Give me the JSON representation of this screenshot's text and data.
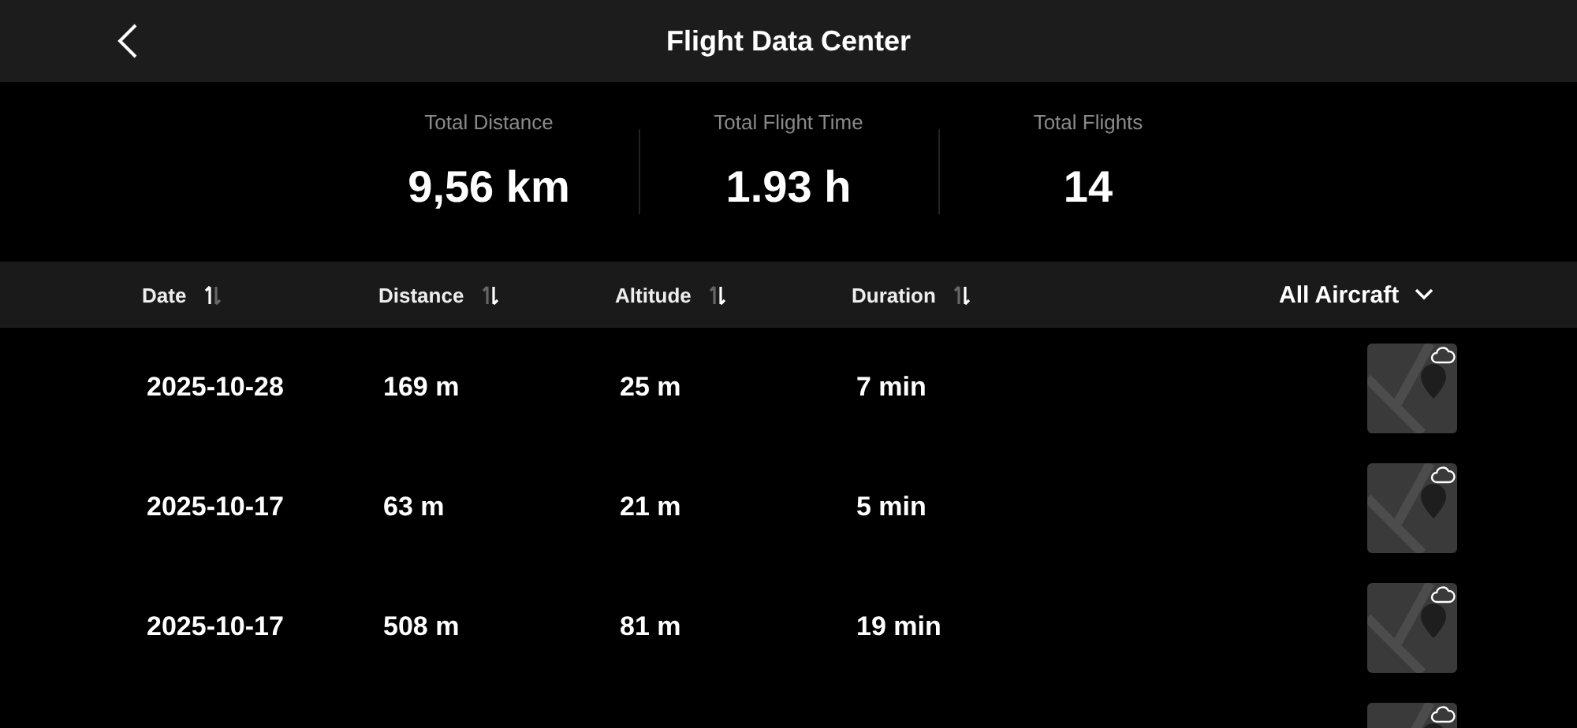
{
  "header": {
    "title": "Flight Data Center"
  },
  "stats": [
    {
      "label": "Total Distance",
      "value": "9,56 km"
    },
    {
      "label": "Total Flight Time",
      "value": "1.93 h"
    },
    {
      "label": "Total Flights",
      "value": "14"
    }
  ],
  "columns": [
    {
      "label": "Date",
      "ascending": true
    },
    {
      "label": "Distance",
      "ascending": false
    },
    {
      "label": "Altitude",
      "ascending": false
    },
    {
      "label": "Duration",
      "ascending": false
    }
  ],
  "aircraft_filter": {
    "label": "All Aircraft"
  },
  "rows": [
    {
      "date": "2025-10-28",
      "distance": "169 m",
      "altitude": "25 m",
      "duration": "7 min",
      "cloud_synced": true
    },
    {
      "date": "2025-10-17",
      "distance": "63 m",
      "altitude": "21 m",
      "duration": "5 min",
      "cloud_synced": true
    },
    {
      "date": "2025-10-17",
      "distance": "508 m",
      "altitude": "81 m",
      "duration": "19 min",
      "cloud_synced": true
    },
    {
      "cloud_synced": true
    }
  ]
}
